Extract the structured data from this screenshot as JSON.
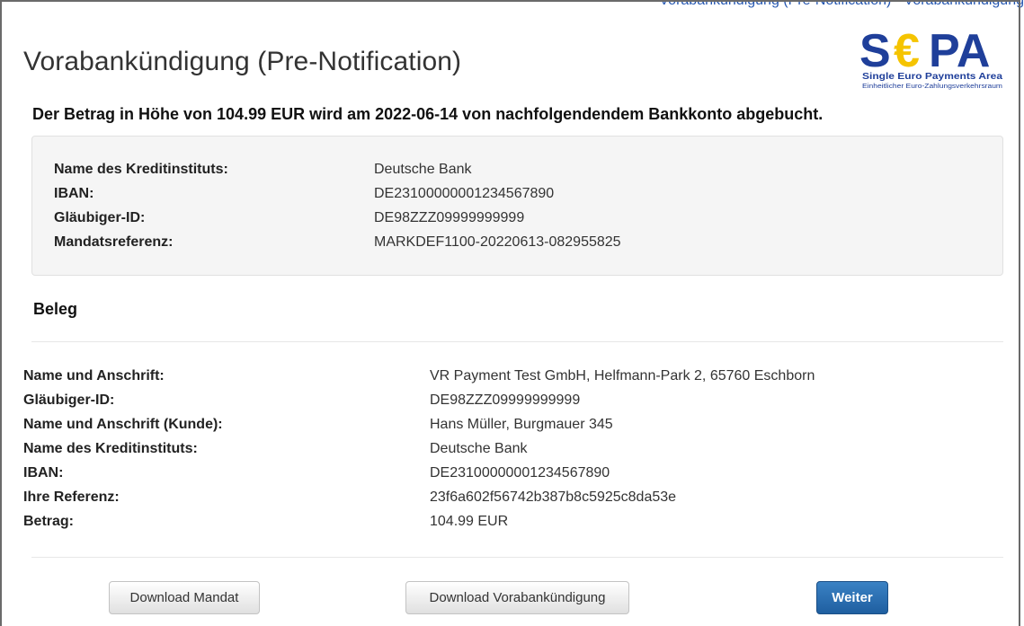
{
  "title": "Vorabankündigung (Pre-Notification)",
  "top_fragment": "Vorabankündigung (Pre-Notification) · Vorabankündigung",
  "statement": "Der Betrag in Höhe von 104.99 EUR wird am 2022-06-14 von nachfolgendendem Bankkonto abgebucht.",
  "logo": {
    "text": "SEPA",
    "euro_glyph": "€",
    "line1": "Single Euro Payments Area",
    "line2": "Einheitlicher Euro-Zahlungsverkehrsraum",
    "color_blue": "#1f3f9a",
    "color_yellow": "#f5c400"
  },
  "bank_account": {
    "rows": [
      {
        "label": "Name des Kreditinstituts:",
        "value": "Deutsche Bank"
      },
      {
        "label": "IBAN:",
        "value": "DE23100000001234567890"
      },
      {
        "label": "Gläubiger-ID:",
        "value": "DE98ZZZ09999999999"
      },
      {
        "label": "Mandatsreferenz:",
        "value": "MARKDEF1100-20220613-082955825"
      }
    ]
  },
  "beleg": {
    "heading": "Beleg",
    "rows": [
      {
        "label": "Name und Anschrift:",
        "value": "VR Payment Test GmbH, Helfmann-Park 2, 65760 Eschborn"
      },
      {
        "label": "Gläubiger-ID:",
        "value": "DE98ZZZ09999999999"
      },
      {
        "label": "Name und Anschrift (Kunde):",
        "value": "Hans Müller, Burgmauer 345"
      },
      {
        "label": "Name des Kreditinstituts:",
        "value": "Deutsche Bank"
      },
      {
        "label": "IBAN:",
        "value": "DE23100000001234567890"
      },
      {
        "label": "Ihre Referenz:",
        "value": "23f6a602f56742b387b8c5925c8da53e"
      },
      {
        "label": "Betrag:",
        "value": "104.99 EUR"
      }
    ]
  },
  "buttons": {
    "download_mandate": "Download Mandat",
    "download_prenotification": "Download Vorabankündigung",
    "continue": "Weiter"
  },
  "colors": {
    "primary": "#286090",
    "well_bg": "#f5f5f5"
  }
}
